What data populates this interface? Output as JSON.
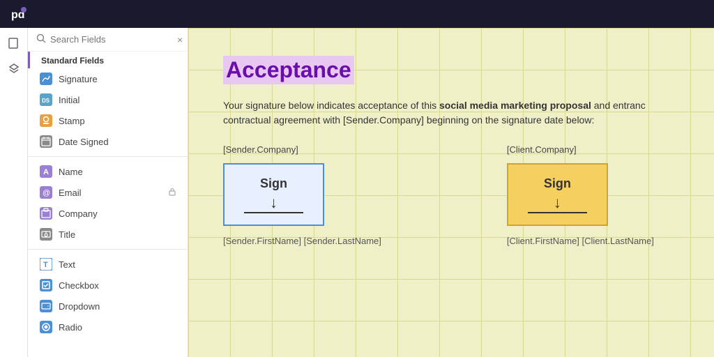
{
  "app": {
    "title": "PandaDoc"
  },
  "sidebar": {
    "search_placeholder": "Search Fields",
    "section_label": "Standard Fields",
    "close_label": "×",
    "items_group1": [
      {
        "id": "signature",
        "label": "Signature",
        "icon_type": "pen",
        "icon_color": "blue"
      },
      {
        "id": "initial",
        "label": "Initial",
        "icon_type": "DS",
        "icon_color": "teal"
      },
      {
        "id": "stamp",
        "label": "Stamp",
        "icon_type": "stamp",
        "icon_color": "orange"
      },
      {
        "id": "date-signed",
        "label": "Date Signed",
        "icon_type": "calendar",
        "icon_color": "gray"
      }
    ],
    "items_group2": [
      {
        "id": "name",
        "label": "Name",
        "icon_type": "A",
        "icon_color": "purple"
      },
      {
        "id": "email",
        "label": "Email",
        "icon_type": "@",
        "icon_color": "purple",
        "locked": true
      },
      {
        "id": "company",
        "label": "Company",
        "icon_type": "building",
        "icon_color": "purple"
      },
      {
        "id": "title",
        "label": "Title",
        "icon_type": "lock",
        "icon_color": "gray"
      }
    ],
    "items_group3": [
      {
        "id": "text",
        "label": "Text",
        "icon_type": "T",
        "icon_color": "outline"
      },
      {
        "id": "checkbox",
        "label": "Checkbox",
        "icon_type": "check",
        "icon_color": "blue"
      },
      {
        "id": "dropdown",
        "label": "Dropdown",
        "icon_type": "dropdown",
        "icon_color": "blue"
      },
      {
        "id": "radio",
        "label": "Radio",
        "icon_type": "radio",
        "icon_color": "blue"
      }
    ]
  },
  "document": {
    "title": "Acceptance",
    "paragraph": "Your signature below indicates acceptance of this social media marketing proposal and entranc contractual agreement with [Sender.Company] beginning on the signature date below:",
    "paragraph_bold": "social media marketing proposal",
    "sender_label": "[Sender.Company]",
    "client_label": "[Client.Company]",
    "sign_button_label": "Sign",
    "sender_name_label": "[Sender.FirstName] [Sender.LastName]",
    "client_name_label": "[Client.FirstName] [Client.LastName]"
  },
  "icons": {
    "search": "🔍",
    "close": "✕",
    "pages": "⬜",
    "layers": "⟳",
    "pen": "✏",
    "stamp": "⊕",
    "calendar": "▦",
    "person": "👤",
    "lock": "🔒",
    "arrow_down": "↓"
  }
}
